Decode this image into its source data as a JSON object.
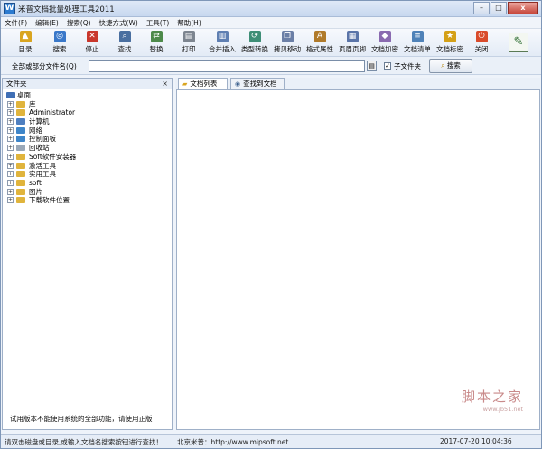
{
  "window": {
    "title": "米普文档批量处理工具2011",
    "minimize": "–",
    "maximize": "□",
    "close": "x"
  },
  "menu": [
    "文件(F)",
    "编辑(E)",
    "搜索(Q)",
    "快捷方式(W)",
    "工具(T)",
    "帮助(H)"
  ],
  "toolbar": [
    {
      "label": "目录",
      "icon": "folder-up-icon",
      "glyph": "▲",
      "color": "#d9a520"
    },
    {
      "label": "搜索",
      "icon": "search-doc-icon",
      "glyph": "◎",
      "color": "#3a78c9"
    },
    {
      "label": "停止",
      "icon": "stop-icon",
      "glyph": "✕",
      "color": "#c9372c"
    },
    {
      "label": "查找",
      "icon": "find-icon",
      "glyph": "⌕",
      "color": "#4a6fa0"
    },
    {
      "label": "替换",
      "icon": "replace-icon",
      "glyph": "⇄",
      "color": "#4d8a4a"
    },
    {
      "label": "打印",
      "icon": "printer-icon",
      "glyph": "▤",
      "color": "#7d8590"
    },
    {
      "label": "合并插入",
      "icon": "merge-icon",
      "glyph": "▥",
      "color": "#5f7fb2"
    },
    {
      "label": "类型转换",
      "icon": "convert-icon",
      "glyph": "⟳",
      "color": "#3e8e76"
    },
    {
      "label": "拷贝移动",
      "icon": "copy-move-icon",
      "glyph": "❐",
      "color": "#6b7fa6"
    },
    {
      "label": "格式属性",
      "icon": "format-icon",
      "glyph": "A",
      "color": "#b07a2a"
    },
    {
      "label": "页眉页脚",
      "icon": "header-footer-icon",
      "glyph": "▦",
      "color": "#5a74a8"
    },
    {
      "label": "文档加密",
      "icon": "encrypt-icon",
      "glyph": "◆",
      "color": "#8a6ab0"
    },
    {
      "label": "文档清单",
      "icon": "list-icon",
      "glyph": "≡",
      "color": "#4f82b8"
    },
    {
      "label": "文档标密",
      "icon": "star-icon",
      "glyph": "★",
      "color": "#d4a017"
    },
    {
      "label": "关闭",
      "icon": "power-icon",
      "glyph": "⏻",
      "color": "#d94b2b"
    }
  ],
  "logo": {
    "glyph": "✎",
    "icon": "app-logo-icon"
  },
  "search": {
    "label": "全部或部分文件名(Q)",
    "value": "",
    "picker": "▤",
    "subfolder_checked": true,
    "subfolder_label": "子文件夹",
    "button": "搜索"
  },
  "left_panel": {
    "title": "文件夹",
    "close": "×",
    "tree": [
      {
        "label": "桌面",
        "root": true,
        "color": "#3f6fb5"
      },
      {
        "label": "库",
        "color": "#e0b43c"
      },
      {
        "label": "Administrator",
        "color": "#e0b43c"
      },
      {
        "label": "计算机",
        "color": "#4e7fc0"
      },
      {
        "label": "网络",
        "color": "#3f86c9"
      },
      {
        "label": "控制面板",
        "color": "#3f86c9"
      },
      {
        "label": "回收站",
        "color": "#9aa8b8"
      },
      {
        "label": "Soft软件安装器",
        "color": "#e0b43c"
      },
      {
        "label": "激活工具",
        "color": "#e0b43c"
      },
      {
        "label": "实用工具",
        "color": "#e0b43c"
      },
      {
        "label": "soft",
        "color": "#e0b43c"
      },
      {
        "label": "图片",
        "color": "#e0b43c"
      },
      {
        "label": "下载软件位置",
        "color": "#e0b43c"
      }
    ],
    "footer": "试用版本不能使用系统的全部功能，请使用正版"
  },
  "tabs": {
    "list": "文档列表",
    "found": "查找到文档"
  },
  "watermark": {
    "main": "脚本之家",
    "sub": "www.jb51.net"
  },
  "status": {
    "hint": "请双击磁盘或目录,或输入文档名搜索按钮进行查找！",
    "company": "北京米普：http://www.mipsoft.net",
    "datetime": "2017-07-20 10:04:36"
  }
}
